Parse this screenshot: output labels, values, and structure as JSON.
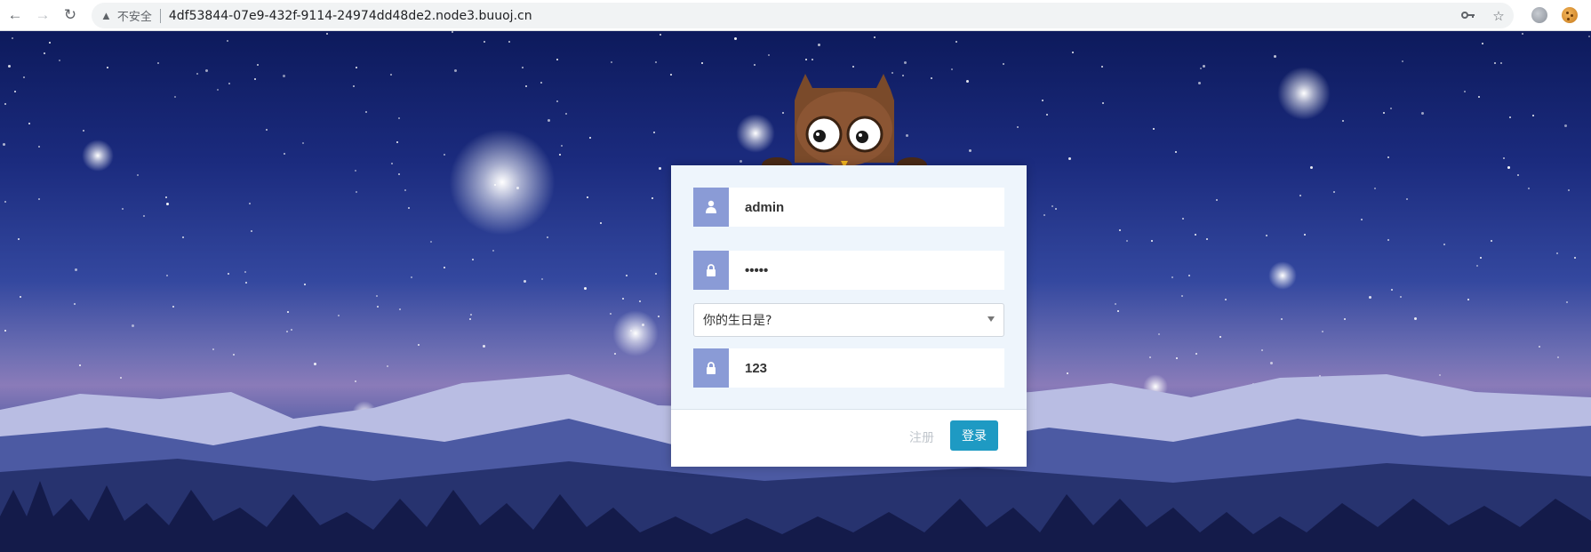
{
  "browser": {
    "security_label": "不安全",
    "url": "4df53844-07e9-432f-9114-24974dd48de2.node3.buuoj.cn",
    "icons": [
      "back-icon",
      "forward-icon",
      "reload-icon",
      "warning-icon",
      "key-icon",
      "star-icon",
      "globe-extension-icon",
      "cookie-extension-icon"
    ]
  },
  "login": {
    "username": "admin",
    "password_masked": "•••••",
    "security_question": "你的生日是?",
    "answer": "123",
    "register_label": "注册",
    "submit_label": "登录"
  },
  "colors": {
    "field_icon_bg": "#8a9bd6",
    "login_button": "#1e9ac3",
    "card_bg": "#eef5fc"
  }
}
